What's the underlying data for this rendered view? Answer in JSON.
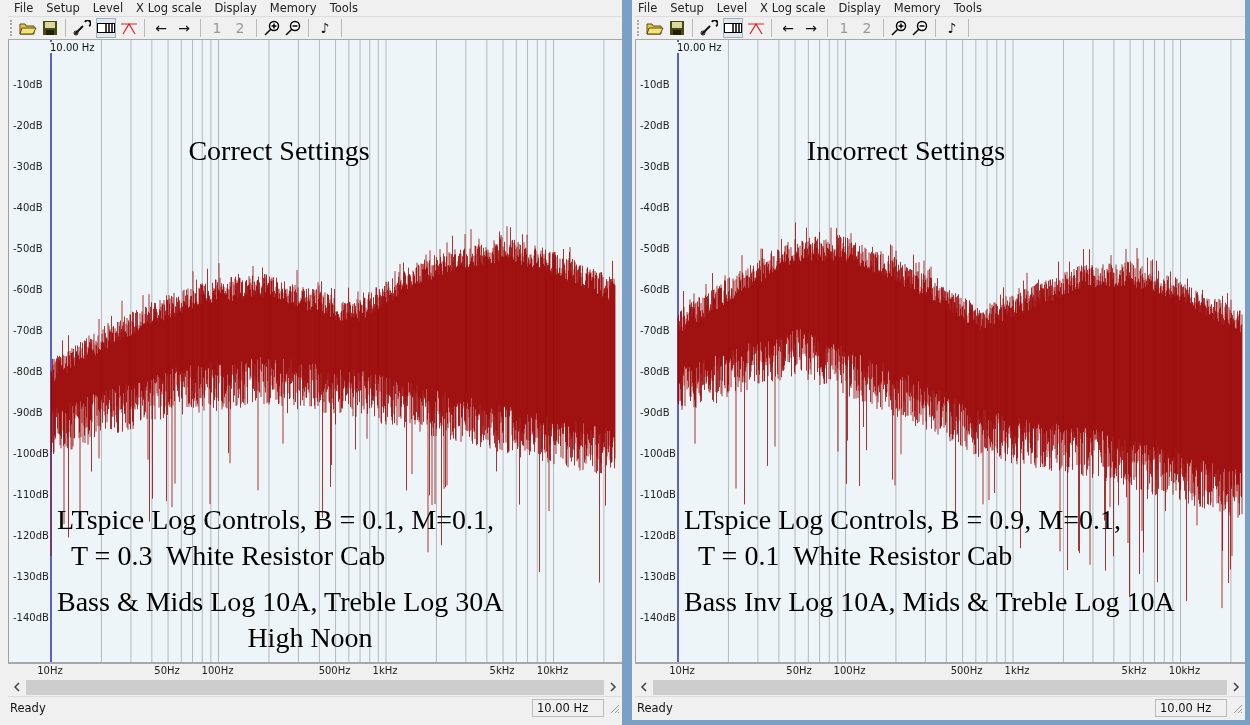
{
  "windows": [
    {
      "menu": [
        "File",
        "Setup",
        "Level",
        "X Log scale",
        "Display",
        "Memory",
        "Tools"
      ],
      "toolbar": {
        "view_pressed": true,
        "arrows": [
          "←",
          "→"
        ],
        "memory": [
          {
            "label": "1",
            "disabled": true
          },
          {
            "label": "2",
            "disabled": true
          }
        ],
        "note": "♪"
      },
      "cursor_label": "10.00 Hz",
      "y_labels": [
        "-10dB",
        "-20dB",
        "-30dB",
        "-40dB",
        "-50dB",
        "-60dB",
        "-70dB",
        "-80dB",
        "-90dB",
        "-100dB",
        "-110dB",
        "-120dB",
        "-130dB",
        "-140dB"
      ],
      "x_labels": [
        "10Hz",
        "50Hz",
        "100Hz",
        "500Hz",
        "1kHz",
        "5kHz",
        "10kHz"
      ],
      "title": "Correct Settings",
      "notes": [
        {
          "kind": "line",
          "text": "LTspice Log Controls, B = 0.1, M=0.1,"
        },
        {
          "kind": "indent",
          "text": "T = 0.3  White Resistor Cab"
        },
        {
          "kind": "break",
          "text": "Bass & Mids Log 10A, Treble Log 30A"
        },
        {
          "kind": "center",
          "text": "High Noon"
        }
      ],
      "status": "Ready",
      "status_field": "10.00 Hz"
    },
    {
      "menu": [
        "File",
        "Setup",
        "Level",
        "X Log scale",
        "Display",
        "Memory",
        "Tools"
      ],
      "toolbar": {
        "view_pressed": true,
        "arrows": [
          "←",
          "→"
        ],
        "memory": [
          {
            "label": "1",
            "disabled": true
          },
          {
            "label": "2",
            "disabled": true
          }
        ],
        "note": "♪"
      },
      "cursor_label": "10.00 Hz",
      "y_labels": [
        "-10dB",
        "-20dB",
        "-30dB",
        "-40dB",
        "-50dB",
        "-60dB",
        "-70dB",
        "-80dB",
        "-90dB",
        "-100dB",
        "-110dB",
        "-120dB",
        "-130dB",
        "-140dB"
      ],
      "x_labels": [
        "10Hz",
        "50Hz",
        "100Hz",
        "500Hz",
        "1kHz",
        "5kHz",
        "10kHz"
      ],
      "title": "Incorrect Settings",
      "notes": [
        {
          "kind": "line",
          "text": "LTspice Log Controls, B = 0.9, M=0.1,"
        },
        {
          "kind": "indent",
          "text": "T = 0.1  White Resistor Cab"
        },
        {
          "kind": "break",
          "text": "Bass Inv Log 10A, Mids & Treble Log 10A"
        }
      ],
      "status": "Ready",
      "status_field": "10.00 Hz"
    }
  ]
}
